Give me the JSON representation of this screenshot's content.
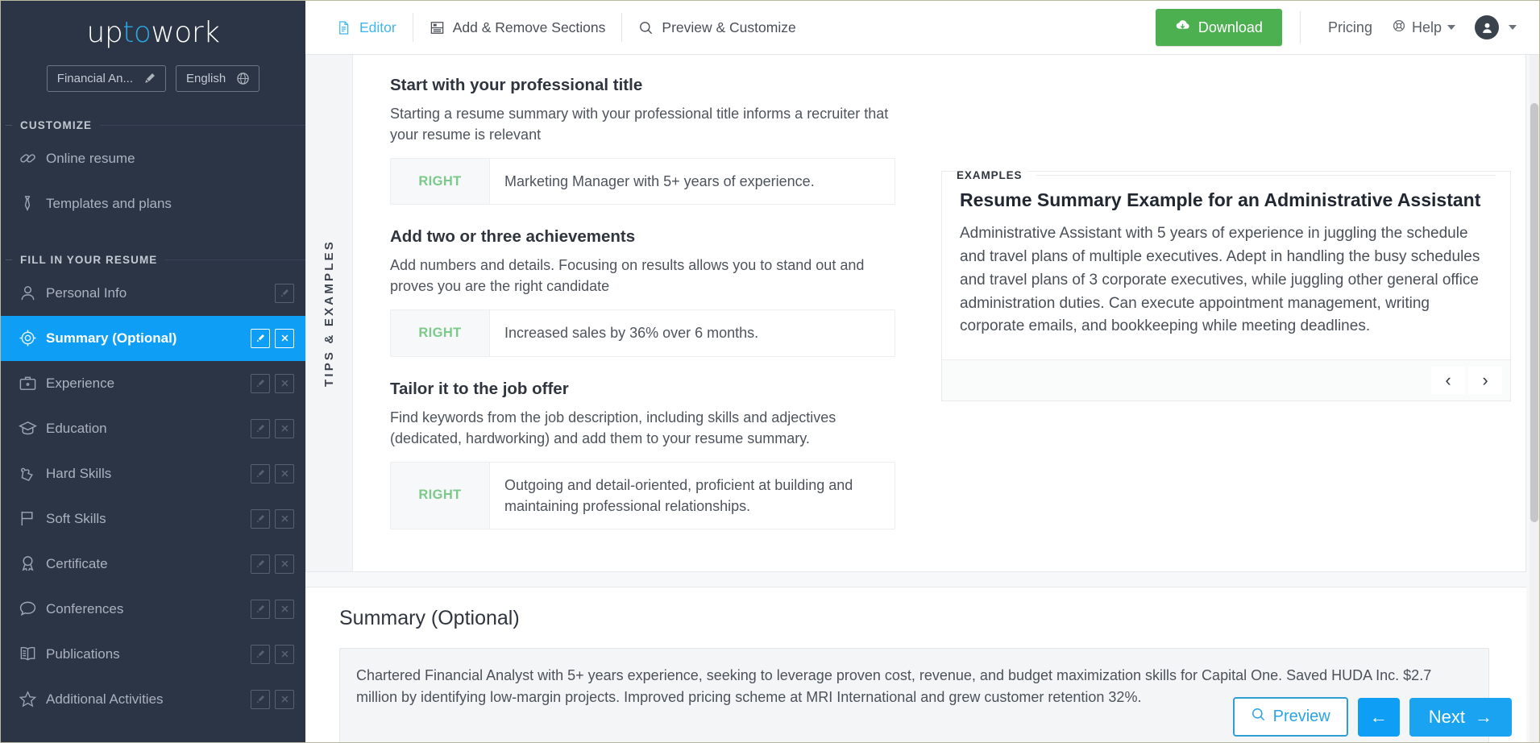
{
  "brand": {
    "logo_part1": "up",
    "logo_accent": "to",
    "logo_part2": "work",
    "accent_color": "#2ba6e0"
  },
  "sidebar": {
    "resume_name": "Financial An...",
    "language": "English",
    "groups": [
      {
        "title": "CUSTOMIZE",
        "items": [
          {
            "label": "Online resume",
            "icon": "link-icon",
            "active": false,
            "has_actions": false
          },
          {
            "label": "Templates and plans",
            "icon": "tie-icon",
            "active": false,
            "has_actions": false
          }
        ]
      },
      {
        "title": "FILL IN YOUR RESUME",
        "items": [
          {
            "label": "Personal Info",
            "icon": "user-icon",
            "active": false,
            "has_actions": "edit"
          },
          {
            "label": "Summary (Optional)",
            "icon": "target-icon",
            "active": true,
            "has_actions": "both"
          },
          {
            "label": "Experience",
            "icon": "briefcase-icon",
            "active": false,
            "has_actions": "both"
          },
          {
            "label": "Education",
            "icon": "graduation-cap-icon",
            "active": false,
            "has_actions": "both"
          },
          {
            "label": "Hard Skills",
            "icon": "puzzle-icon",
            "active": false,
            "has_actions": "both"
          },
          {
            "label": "Soft Skills",
            "icon": "flag-icon",
            "active": false,
            "has_actions": "both"
          },
          {
            "label": "Certificate",
            "icon": "award-ribbon-icon",
            "active": false,
            "has_actions": "both"
          },
          {
            "label": "Conferences",
            "icon": "speech-bubble-icon",
            "active": false,
            "has_actions": "both"
          },
          {
            "label": "Publications",
            "icon": "open-book-icon",
            "active": false,
            "has_actions": "both"
          },
          {
            "label": "Additional Activities",
            "icon": "star-icon",
            "active": false,
            "has_actions": "both"
          }
        ]
      }
    ]
  },
  "topbar": {
    "tabs": [
      {
        "label": "Editor",
        "icon": "document-icon",
        "active": true
      },
      {
        "label": "Add & Remove Sections",
        "icon": "layout-sections-icon",
        "active": false
      },
      {
        "label": "Preview & Customize",
        "icon": "search-icon",
        "active": false
      }
    ],
    "download_label": "Download",
    "download_color": "#4caf50",
    "pricing_label": "Pricing",
    "help_label": "Help"
  },
  "tips": {
    "vertical_label": "TIPS & EXAMPLES",
    "right_tag": "RIGHT",
    "entries": [
      {
        "title": "Start with your professional title",
        "desc": "Starting a resume summary with your professional title informs a recruiter that your resume is relevant",
        "example": "Marketing Manager with 5+ years of experience."
      },
      {
        "title": "Add two or three achievements",
        "desc": "Add numbers and details. Focusing on results allows you to stand out and proves you are the right candidate",
        "example": "Increased sales by 36% over 6 months."
      },
      {
        "title": "Tailor it to the job offer",
        "desc": "Find keywords from the job description, including skills and adjectives (dedicated, hardworking) and add them to your resume summary.",
        "example": "Outgoing and detail-oriented, proficient at building and maintaining professional relationships."
      }
    ]
  },
  "examples": {
    "label": "EXAMPLES",
    "title": "Resume Summary Example for an Administrative Assistant",
    "body": "Administrative Assistant with 5 years of experience in juggling the schedule and travel plans of multiple executives. Adept in handling the busy schedules and travel plans of 3 corporate executives, while juggling other general office administration duties. Can execute appointment management, writing corporate emails, and bookkeeping while meeting deadlines.",
    "prev_label": "‹",
    "next_label": "›"
  },
  "summary": {
    "heading": "Summary (Optional)",
    "value": "Chartered Financial Analyst with 5+ years experience, seeking to leverage proven cost, revenue, and budget maximization skills for Capital One. Saved HUDA Inc. $2.7 million by identifying low-margin projects. Improved pricing scheme at MRI International and grew customer retention 32%."
  },
  "actions": {
    "preview_label": "Preview",
    "back_label": "←",
    "next_label": "Next",
    "next_arrow": "→"
  }
}
